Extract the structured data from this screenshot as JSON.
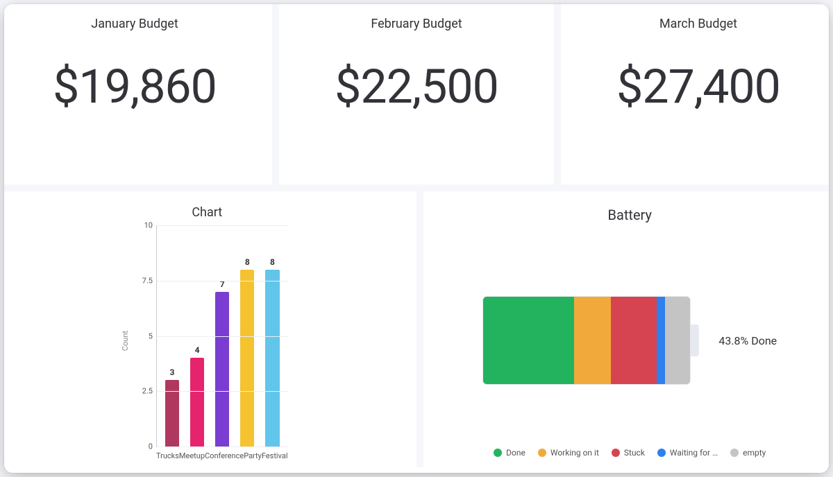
{
  "budgets": [
    {
      "title": "January Budget",
      "value": "$19,860"
    },
    {
      "title": "February Budget",
      "value": "$22,500"
    },
    {
      "title": "March Budget",
      "value": "$27,400"
    }
  ],
  "chart_data": [
    {
      "type": "bar",
      "title": "Chart",
      "ylabel": "Count",
      "xlabel": "",
      "ylim": [
        0,
        10
      ],
      "yticks": [
        0,
        2.5,
        5,
        7.5,
        10
      ],
      "categories": [
        "Trucks",
        "Meetup",
        "Conference",
        "Party",
        "Festival"
      ],
      "values": [
        3,
        4,
        7,
        8,
        8
      ],
      "colors": [
        "#b0385f",
        "#e6246d",
        "#7a3dd1",
        "#f5c330",
        "#62c5ea"
      ]
    },
    {
      "type": "battery",
      "title": "Battery",
      "label": "43.8% Done",
      "segments": [
        {
          "name": "Done",
          "percent": 43.8,
          "color": "#23b35f"
        },
        {
          "name": "Working on it",
          "percent": 18.0,
          "color": "#f2a93b"
        },
        {
          "name": "Stuck",
          "percent": 22.0,
          "color": "#d64451"
        },
        {
          "name": "Waiting for …",
          "percent": 4.0,
          "color": "#2f80ed"
        },
        {
          "name": "empty",
          "percent": 12.2,
          "color": "#c4c4c4"
        }
      ],
      "legend": [
        {
          "name": "Done",
          "color": "#23b35f"
        },
        {
          "name": "Working on it",
          "color": "#f2a93b"
        },
        {
          "name": "Stuck",
          "color": "#d64451"
        },
        {
          "name": "Waiting for …",
          "color": "#2f80ed"
        },
        {
          "name": "empty",
          "color": "#c4c4c4"
        }
      ]
    }
  ]
}
